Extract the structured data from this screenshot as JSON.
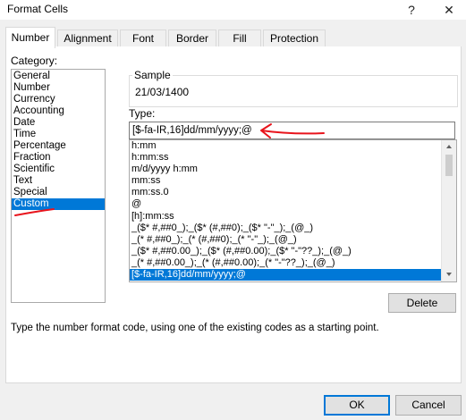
{
  "window": {
    "title": "Format Cells",
    "help_glyph": "?",
    "close_glyph": "✕"
  },
  "tabs": [
    {
      "label": "Number",
      "active": true
    },
    {
      "label": "Alignment"
    },
    {
      "label": "Font"
    },
    {
      "label": "Border"
    },
    {
      "label": "Fill"
    },
    {
      "label": "Protection"
    }
  ],
  "category": {
    "label": "Category:",
    "items": [
      "General",
      "Number",
      "Currency",
      "Accounting",
      "Date",
      "Time",
      "Percentage",
      "Fraction",
      "Scientific",
      "Text",
      "Special",
      "Custom"
    ],
    "selected": "Custom"
  },
  "sample": {
    "label": "Sample",
    "value": "21/03/1400"
  },
  "type": {
    "label": "Type:",
    "value": "[$-fa-IR,16]dd/mm/yyyy;@",
    "formats": [
      "h:mm",
      "h:mm:ss",
      "m/d/yyyy h:mm",
      "mm:ss",
      "mm:ss.0",
      "@",
      "[h]:mm:ss",
      "_($* #,##0_);_($* (#,##0);_($* \"-\"_);_(@_)",
      "_(* #,##0_);_(* (#,##0);_(* \"-\"_);_(@_)",
      "_($* #,##0.00_);_($* (#,##0.00);_($* \"-\"??_);_(@_)",
      "_(* #,##0.00_);_(* (#,##0.00);_(* \"-\"??_);_(@_)",
      "[$-fa-IR,16]dd/mm/yyyy;@"
    ],
    "selected_format": "[$-fa-IR,16]dd/mm/yyyy;@"
  },
  "delete_label": "Delete",
  "hint": "Type the number format code, using one of the existing codes as a starting point.",
  "ok_label": "OK",
  "cancel_label": "Cancel",
  "colors": {
    "selection": "#0078d7",
    "annotation": "#e8141c"
  }
}
